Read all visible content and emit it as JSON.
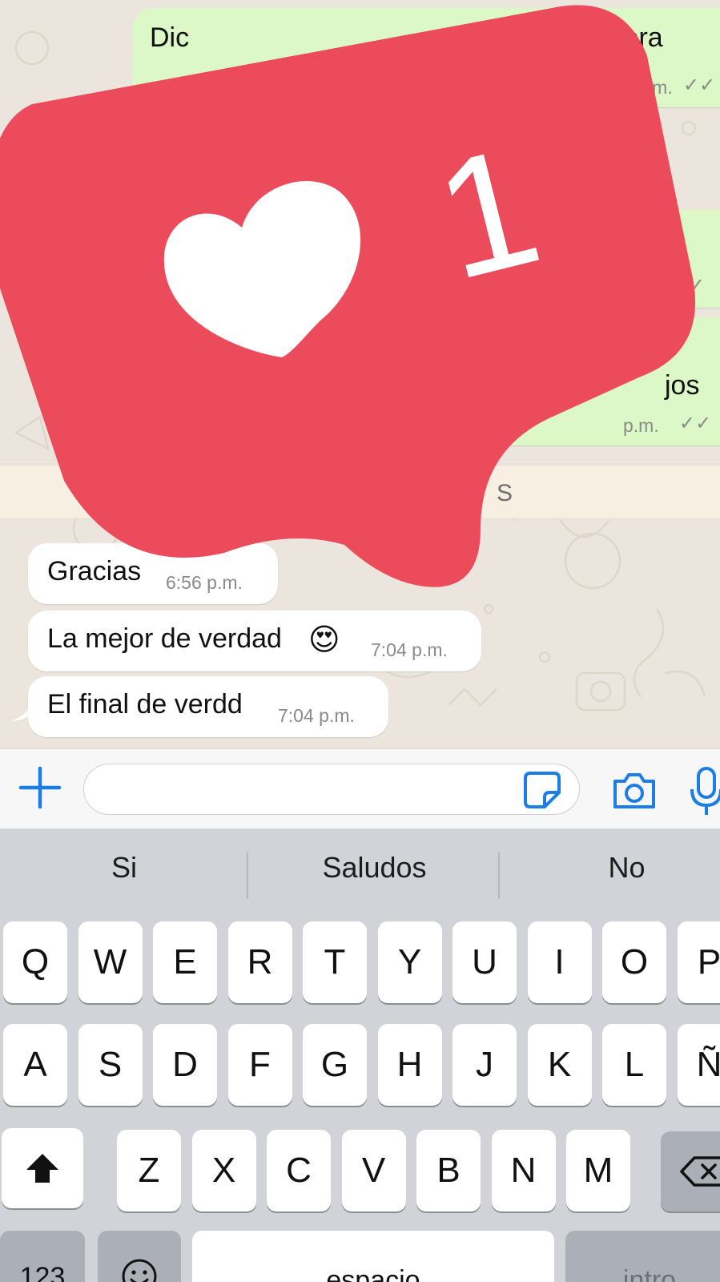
{
  "chat": {
    "outgoing": [
      {
        "text": "Dic",
        "text_end": "lora",
        "time": "p.m."
      },
      {
        "text_end": "jos",
        "time": "p.m."
      }
    ],
    "unread_banner": "S",
    "incoming": [
      {
        "text": "Gracias",
        "time": "6:56 p.m."
      },
      {
        "text": "La mejor de verdad",
        "emoji": "😍",
        "time": "7:04 p.m."
      },
      {
        "text": "El final de verdd",
        "time": "7:04 p.m."
      }
    ]
  },
  "like_sticker": {
    "count": "1",
    "color": "#ec4b5b",
    "icon": "heart-icon"
  },
  "input_bar": {
    "placeholder": "",
    "icons": [
      "plus-icon",
      "sticker-icon",
      "camera-icon",
      "microphone-icon"
    ],
    "accent": "#1a7ee6"
  },
  "keyboard": {
    "suggestions": [
      "Si",
      "Saludos",
      "No"
    ],
    "row1": [
      "Q",
      "W",
      "E",
      "R",
      "T",
      "Y",
      "U",
      "I",
      "O",
      "P"
    ],
    "row2": [
      "A",
      "S",
      "D",
      "F",
      "G",
      "H",
      "J",
      "K",
      "L",
      "Ñ"
    ],
    "row3": [
      "Z",
      "X",
      "C",
      "V",
      "B",
      "N",
      "M"
    ],
    "numbers_key": "123",
    "space_key": "espacio",
    "return_key": "intro",
    "shift_icon": "shift-icon",
    "delete_icon": "delete-icon",
    "emoji_icon": "emoji-icon"
  }
}
